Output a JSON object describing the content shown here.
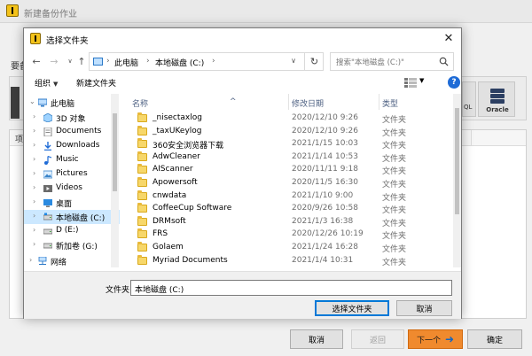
{
  "background_app": {
    "title": "新建备份作业",
    "tab_label": "源",
    "left_label": "要备",
    "list_header": "项",
    "tool_sql_label": "QL",
    "tool_oracle_label": "Oracle",
    "buttons": {
      "cancel": "取消",
      "back": "返回",
      "next": "下一个",
      "ok": "确定"
    }
  },
  "dialog": {
    "title": "选择文件夹",
    "close_glyph": "✕",
    "address": {
      "parts": [
        "此电脑",
        "本地磁盘 (C:)"
      ]
    },
    "search_placeholder": "搜索\"本地磁盘 (C:)\"",
    "toolbar": {
      "organize": "组织",
      "new_folder": "新建文件夹",
      "help": "?"
    },
    "nav_tree": [
      {
        "label": "此电脑",
        "icon": "computer-icon",
        "level": 0,
        "expanded": true,
        "selected": false
      },
      {
        "label": "3D 对象",
        "icon": "3d-objects-icon",
        "level": 1,
        "expanded": false,
        "selected": false
      },
      {
        "label": "Documents",
        "icon": "documents-icon",
        "level": 1,
        "expanded": false,
        "selected": false
      },
      {
        "label": "Downloads",
        "icon": "downloads-icon",
        "level": 1,
        "expanded": false,
        "selected": false
      },
      {
        "label": "Music",
        "icon": "music-icon",
        "level": 1,
        "expanded": false,
        "selected": false
      },
      {
        "label": "Pictures",
        "icon": "pictures-icon",
        "level": 1,
        "expanded": false,
        "selected": false
      },
      {
        "label": "Videos",
        "icon": "videos-icon",
        "level": 1,
        "expanded": false,
        "selected": false
      },
      {
        "label": "桌面",
        "icon": "desktop-icon",
        "level": 1,
        "expanded": false,
        "selected": false
      },
      {
        "label": "本地磁盘 (C:)",
        "icon": "drive-icon",
        "level": 1,
        "expanded": false,
        "selected": true
      },
      {
        "label": "D (E:)",
        "icon": "drive-icon",
        "level": 1,
        "expanded": false,
        "selected": false
      },
      {
        "label": "新加卷 (G:)",
        "icon": "drive-icon",
        "level": 1,
        "expanded": false,
        "selected": false
      },
      {
        "label": "网络",
        "icon": "network-icon",
        "level": 0,
        "expanded": false,
        "selected": false
      }
    ],
    "columns": {
      "name": "名称",
      "modified": "修改日期",
      "type": "类型"
    },
    "files": [
      {
        "name": "_nisectaxlog",
        "modified": "2020/12/10 9:26",
        "type": "文件夹"
      },
      {
        "name": "_taxUKeylog",
        "modified": "2020/12/10 9:26",
        "type": "文件夹"
      },
      {
        "name": "360安全浏览器下载",
        "modified": "2021/1/15 10:03",
        "type": "文件夹"
      },
      {
        "name": "AdwCleaner",
        "modified": "2021/1/14 10:53",
        "type": "文件夹"
      },
      {
        "name": "AIScanner",
        "modified": "2020/11/11 9:18",
        "type": "文件夹"
      },
      {
        "name": "Apowersoft",
        "modified": "2020/11/5 16:30",
        "type": "文件夹"
      },
      {
        "name": "cnwdata",
        "modified": "2021/1/10 9:00",
        "type": "文件夹"
      },
      {
        "name": "CoffeeCup Software",
        "modified": "2020/9/26 10:58",
        "type": "文件夹"
      },
      {
        "name": "DRMsoft",
        "modified": "2021/1/3 16:38",
        "type": "文件夹"
      },
      {
        "name": "FRS",
        "modified": "2020/12/26 10:19",
        "type": "文件夹"
      },
      {
        "name": "Golaem",
        "modified": "2021/1/24 16:28",
        "type": "文件夹"
      },
      {
        "name": "Myriad Documents",
        "modified": "2021/1/4 10:31",
        "type": "文件夹"
      }
    ],
    "folder_label": "文件夹:",
    "folder_value": "本地磁盘 (C:)",
    "select_button": "选择文件夹",
    "cancel_button": "取消"
  },
  "colors": {
    "accent": "#0078d7",
    "selected_bg": "#cce8ff",
    "next_button": "#f08a2e",
    "folder": "#f7d76a"
  }
}
